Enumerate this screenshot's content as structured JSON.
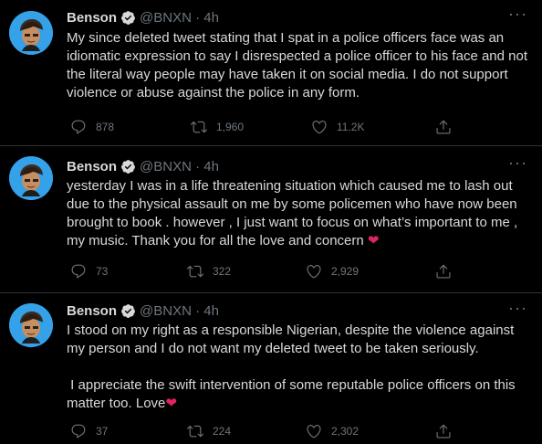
{
  "tweets": [
    {
      "name": "Benson",
      "handle": "@BNXN · 4h",
      "text": "My since deleted tweet stating that I spat in a police officers face was an\nidiomatic expression to say I disrespected a police officer to his face and not\nthe literal way people may have taken it on social media. I do not support\nviolence or abuse against the police in any form.",
      "heart_emoji": "",
      "replies": "878",
      "retweets": "1,960",
      "likes": "11.2K"
    },
    {
      "name": "Benson",
      "handle": "@BNXN · 4h",
      "text": "yesterday I was in a life threatening situation which caused me to lash out\ndue to the physical assault on me by some policemen who have now been\nbrought to book . however , I just want to focus on what’s important to me ,\nmy music. Thank you for all the love and concern ",
      "heart_emoji": "❤",
      "replies": "73",
      "retweets": "322",
      "likes": "2,929"
    },
    {
      "name": "Benson",
      "handle": "@BNXN · 4h",
      "text": "I stood on my right as a responsible Nigerian, despite the violence against\nmy person and I do not want my deleted tweet to be taken seriously.\n\n I appreciate the swift intervention of some reputable police officers on this\nmatter too. Love",
      "heart_emoji": "❤",
      "replies": "37",
      "retweets": "224",
      "likes": "2,302"
    }
  ],
  "more_label": "···",
  "colors": {
    "background": "#000000",
    "text": "#d9d9d9",
    "muted": "#6e767d",
    "verified": "#1da1f2",
    "heart": "#e0245e",
    "avatar_bg": "#34a1e8"
  },
  "icons": [
    "reply-icon",
    "retweet-icon",
    "like-icon",
    "share-icon",
    "verified-badge-icon",
    "more-icon"
  ]
}
